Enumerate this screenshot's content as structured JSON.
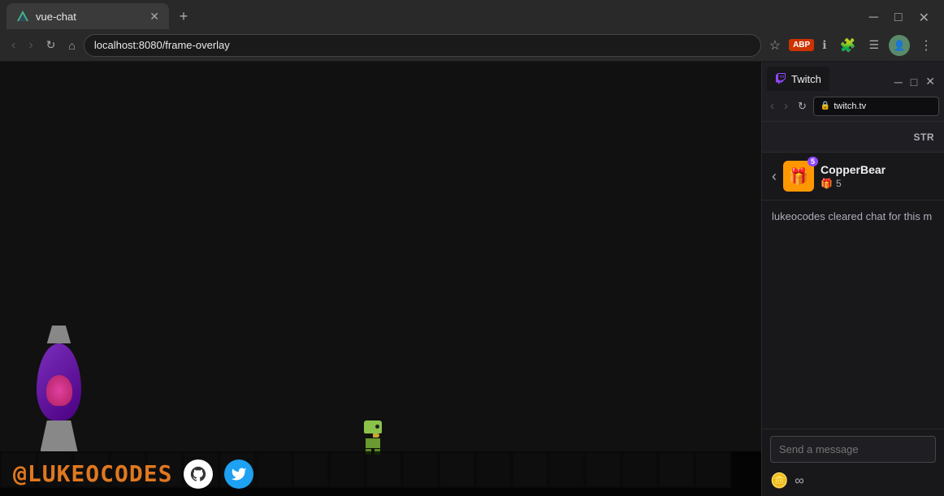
{
  "browser": {
    "tab_title": "vue-chat",
    "address": "localhost:8080/frame-overlay",
    "window_title": "vue-chat"
  },
  "twitch": {
    "title": "Twitch",
    "address": "twitch.tv",
    "stream_label": "STR",
    "user": {
      "name": "CopperBear",
      "badge_icon": "🎁",
      "badge_number": "5"
    },
    "system_message": "lukeocodes cleared chat for this m",
    "message_placeholder": "Send a message"
  },
  "overlay": {
    "username": "@LUKEOCODES"
  }
}
